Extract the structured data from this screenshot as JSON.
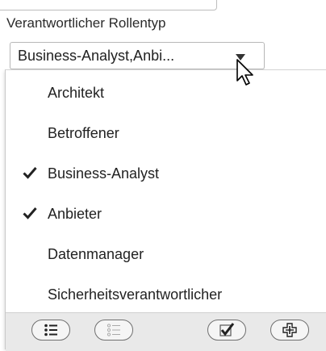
{
  "field": {
    "label": "Verantwortlicher Rollentyp",
    "selected_value": "Business-Analyst,Anbi..."
  },
  "dropdown": {
    "options": [
      {
        "label": "Architekt",
        "checked": false
      },
      {
        "label": "Betroffener",
        "checked": false
      },
      {
        "label": "Business-Analyst",
        "checked": true
      },
      {
        "label": "Anbieter",
        "checked": true
      },
      {
        "label": "Datenmanager",
        "checked": false
      },
      {
        "label": "Sicherheitsverantwortlicher",
        "checked": false
      }
    ],
    "footer_icons": [
      "select-all-icon",
      "deselect-all-icon",
      "confirm-icon",
      "add-icon"
    ]
  },
  "colors": {
    "border": "#b8b8b8",
    "footer_bg": "#e9e9e9",
    "text": "#222222"
  }
}
